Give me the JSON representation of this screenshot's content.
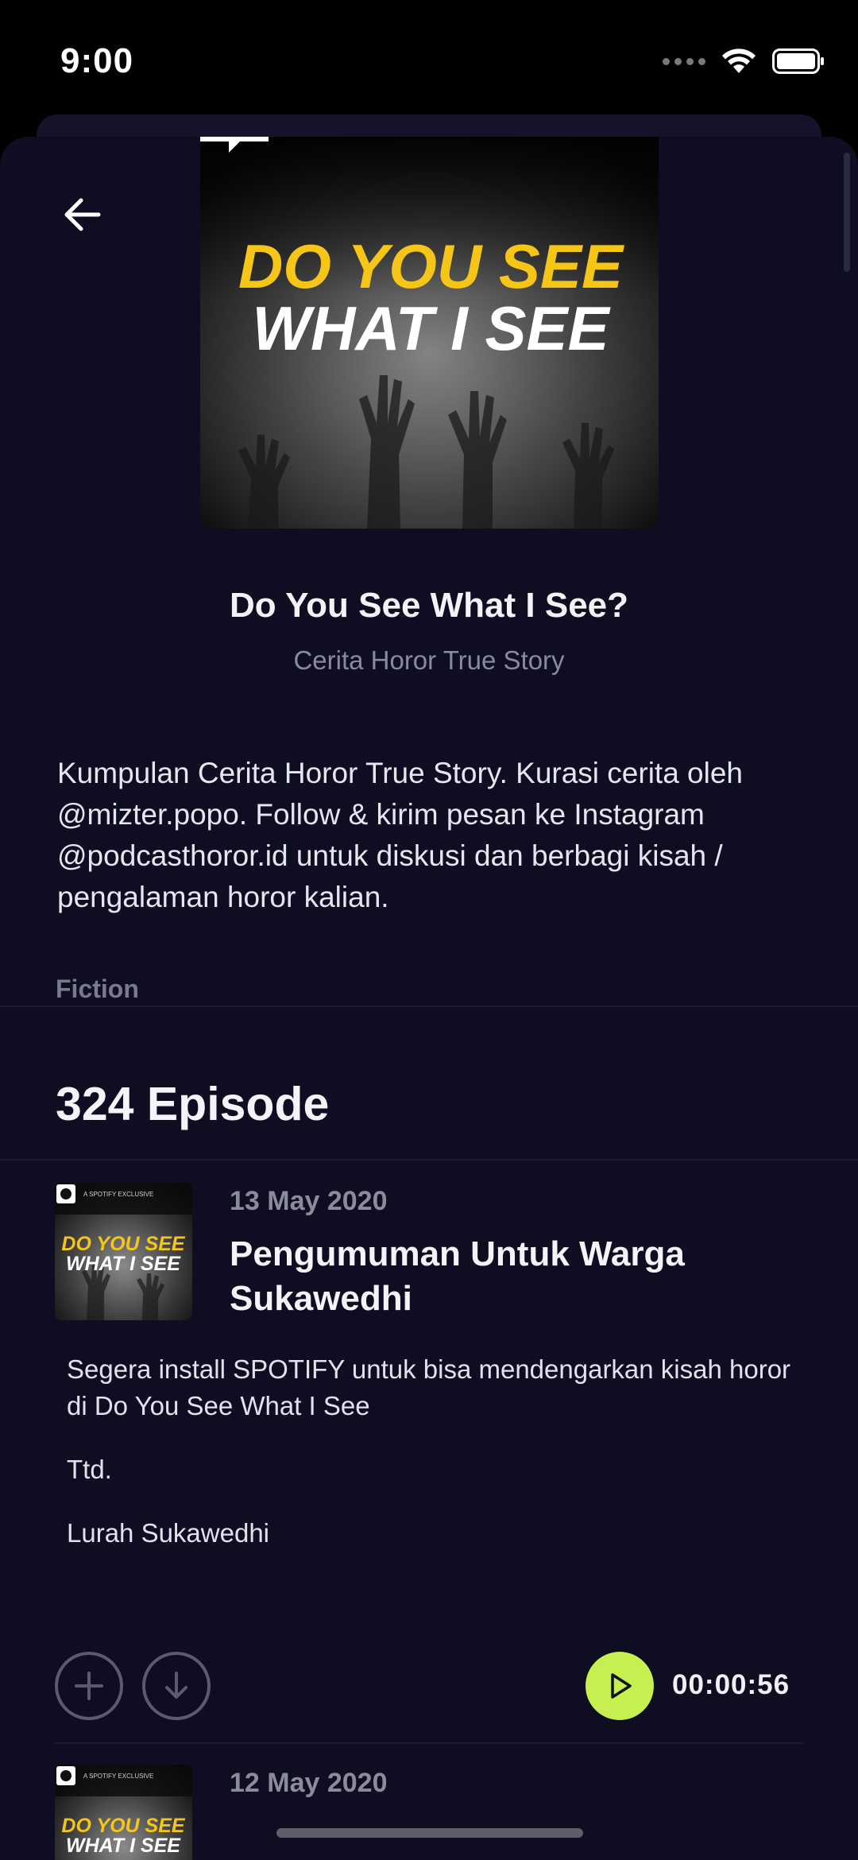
{
  "status_bar": {
    "time": "9:00"
  },
  "podcast": {
    "cover_title_line1": "DO YOU SEE",
    "cover_title_line2": "WHAT I SEE",
    "title": "Do You See What I See?",
    "author": "Cerita Horor True Story",
    "description": "Kumpulan Cerita Horor True Story. Kurasi cerita oleh @mizter.popo. Follow & kirim pesan ke Instagram @podcasthoror.id untuk diskusi dan berbagi kisah / pengalaman horor kalian.",
    "category": "Fiction",
    "episode_count": "324 Episode"
  },
  "episodes": [
    {
      "badge": "A SPOTIFY EXCLUSIVE",
      "thumb_line1": "DO YOU SEE",
      "thumb_line2": "WHAT I SEE",
      "date": "13 May 2020",
      "title": "Pengumuman Untuk Warga Sukawedhi",
      "description": [
        "Segera install SPOTIFY untuk bisa mendengarkan kisah horor di Do You See What I See",
        "Ttd.",
        "Lurah Sukawedhi"
      ],
      "duration": "00:00:56"
    },
    {
      "badge": "A SPOTIFY EXCLUSIVE",
      "thumb_line1": "DO YOU SEE",
      "thumb_line2": "WHAT I SEE",
      "date": "12 May 2020"
    }
  ],
  "colors": {
    "background": "#0e0d22",
    "accent_play": "#c6f04f",
    "cover_title_yellow": "#f5c518"
  },
  "icons": [
    "back-arrow-icon",
    "wifi-icon",
    "battery-icon",
    "add-icon",
    "download-icon",
    "play-icon",
    "spotify-icon"
  ]
}
